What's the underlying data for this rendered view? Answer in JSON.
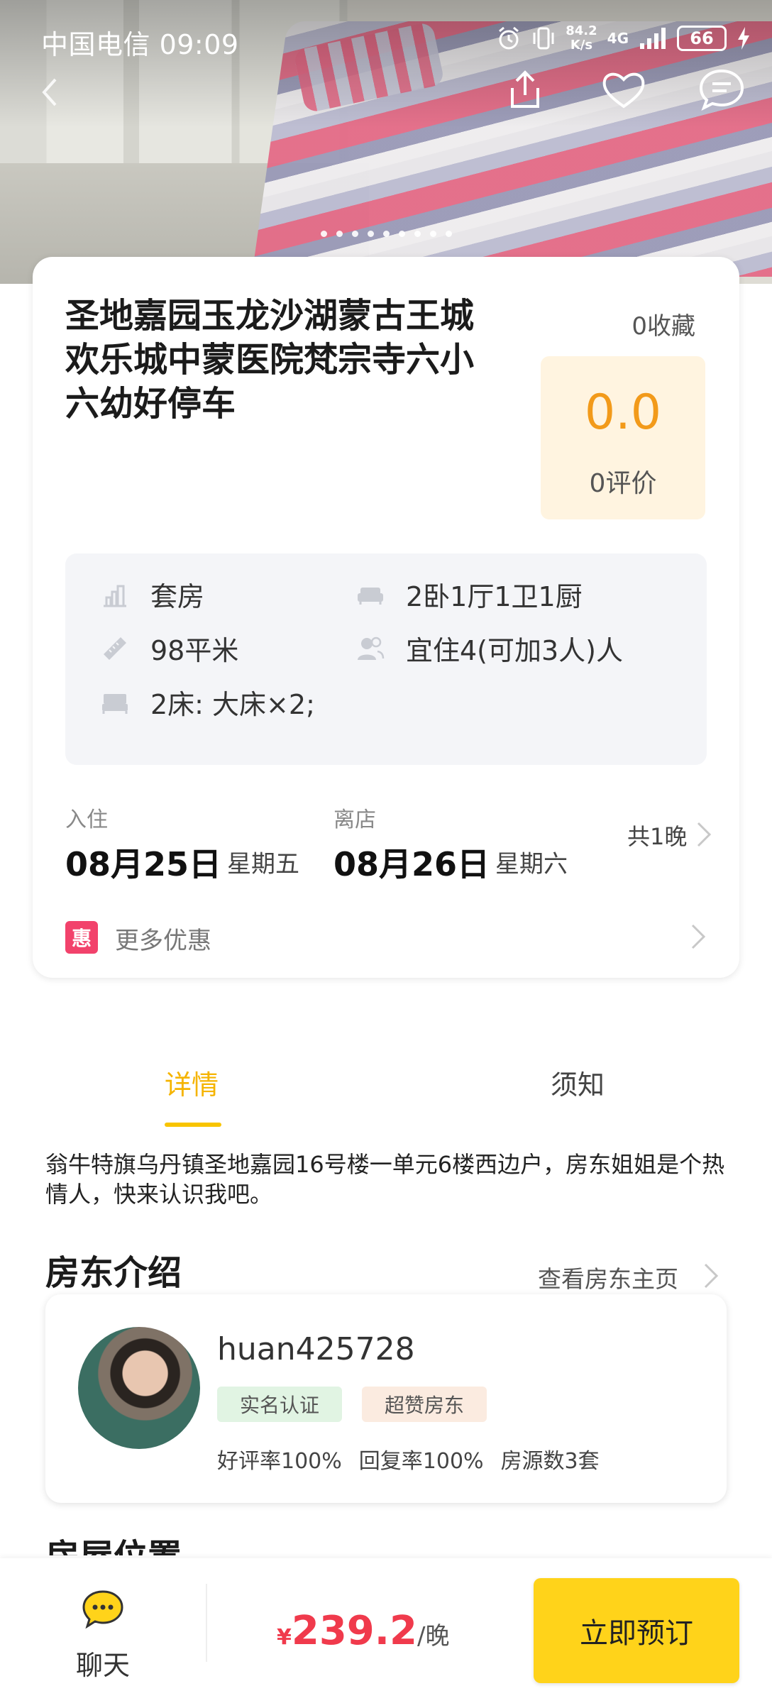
{
  "status_bar": {
    "carrier_time": "中国电信 09:09",
    "net_speed_value": "84.2",
    "net_speed_unit": "K/s",
    "network": "4G",
    "battery": "66"
  },
  "gallery": {
    "dot_count": 9
  },
  "listing": {
    "title": "圣地嘉园玉龙沙湖蒙古王城欢乐城中蒙医院梵宗寺六小六幼好停车",
    "favorites": "0收藏",
    "rating_score": "0.0",
    "rating_count": "0评价",
    "type": "套房",
    "rooms": "2卧1厅1卫1厨",
    "area": "98平米",
    "capacity": "宜住4(可加3人)人",
    "beds": "2床: 大床×2;"
  },
  "dates": {
    "checkin_label": "入住",
    "checkin_date": "08月25日",
    "checkin_weekday": "星期五",
    "checkout_label": "离店",
    "checkout_date": "08月26日",
    "checkout_weekday": "星期六",
    "nights": "共1晚"
  },
  "promo": {
    "badge": "惠",
    "label": "更多优惠"
  },
  "tabs": [
    {
      "label": "详情",
      "active": true
    },
    {
      "label": "须知",
      "active": false
    }
  ],
  "description": "翁牛特旗乌丹镇圣地嘉园16号楼一单元6楼西边户，房东姐姐是个热情人，快来认识我吧。",
  "host_section": {
    "title": "房东介绍",
    "view_link": "查看房东主页",
    "name": "huan425728",
    "tags": [
      "实名认证",
      "超赞房东"
    ],
    "good_rate": "好评率100%",
    "reply_rate": "回复率100%",
    "listings": "房源数3套"
  },
  "next_section_title": "房屋位置",
  "bottom_bar": {
    "chat_label": "聊天",
    "currency": "¥",
    "price": "239.2",
    "price_unit": "/晚",
    "book_label": "立即预订"
  },
  "colors": {
    "accent_yellow": "#ffd31a",
    "price_red": "#f03a4c",
    "rating_orange": "#f29a1a",
    "promo_pink": "#f2426b"
  }
}
